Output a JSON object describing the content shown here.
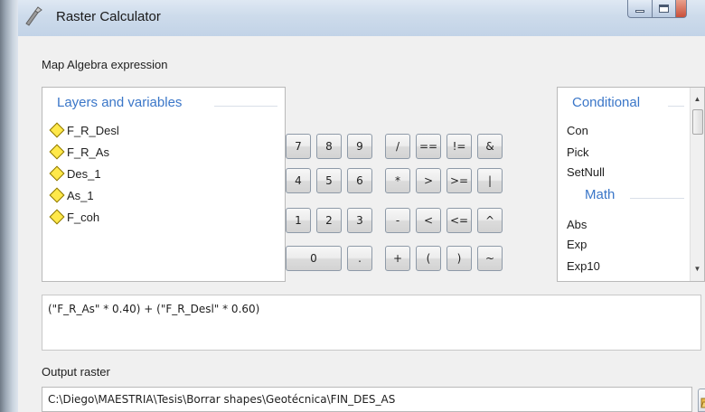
{
  "window": {
    "title": "Raster Calculator"
  },
  "labels": {
    "map_algebra": "Map Algebra expression",
    "output_raster": "Output raster"
  },
  "layers": {
    "header": "Layers and variables",
    "items": [
      "F_R_Desl",
      "F_R_As",
      "Des_1",
      "As_1",
      "F_coh"
    ],
    "icon": "yellow-diamond-icon"
  },
  "buttons": {
    "row1": [
      "7",
      "8",
      "9",
      "/",
      "==",
      "!=",
      "&"
    ],
    "row2": [
      "4",
      "5",
      "6",
      "*",
      ">",
      ">=",
      "|"
    ],
    "row3": [
      "1",
      "2",
      "3",
      "-",
      "<",
      "<=",
      "^"
    ],
    "row4": [
      "0",
      ".",
      "+",
      "(",
      ")",
      "~"
    ]
  },
  "functions": {
    "conditional_header": "Conditional",
    "conditional": [
      "Con",
      "Pick",
      "SetNull"
    ],
    "math_header": "Math",
    "math": [
      "Abs",
      "Exp",
      "Exp10"
    ]
  },
  "expression": "(\"F_R_As\" * 0.40) + (\"F_R_Desl\" * 0.60)",
  "output": {
    "path": "C:\\Diego\\MAESTRIA\\Tesis\\Borrar shapes\\Geotécnica\\FIN_DES_AS"
  },
  "colors": {
    "group_header": "#3a76c8",
    "diamond": "#ffe84a",
    "titlebar": "#cddbeb"
  }
}
